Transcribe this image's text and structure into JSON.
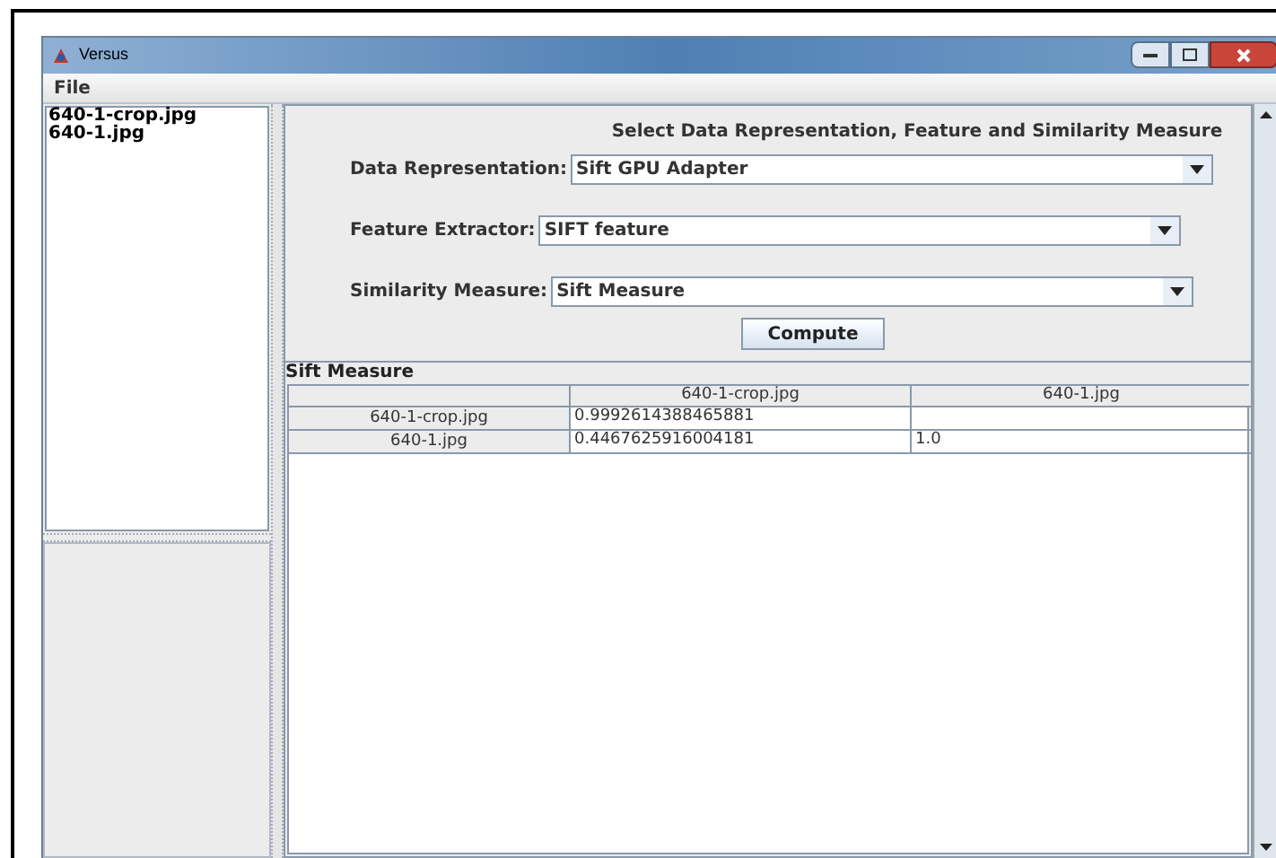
{
  "window": {
    "title": "Versus"
  },
  "menu": [
    "File"
  ],
  "files": [
    "640-1-crop.jpg",
    "640-1.jpg"
  ],
  "form": {
    "heading": "Select Data Representation, Feature and Similarity Measure",
    "fields": [
      {
        "label": "Data Representation:",
        "value": "Sift GPU Adapter"
      },
      {
        "label": "Feature Extractor:",
        "value": "SIFT feature"
      },
      {
        "label": "Similarity Measure:",
        "value": "Sift Measure"
      }
    ],
    "button": "Compute"
  },
  "results": {
    "title": "Sift Measure",
    "columns": [
      "640-1-crop.jpg",
      "640-1.jpg"
    ],
    "rows": [
      {
        "header": "640-1-crop.jpg",
        "cells": [
          "0.9992614388465881",
          ""
        ]
      },
      {
        "header": "640-1.jpg",
        "cells": [
          "0.4467625916004181",
          "1.0"
        ]
      }
    ]
  }
}
